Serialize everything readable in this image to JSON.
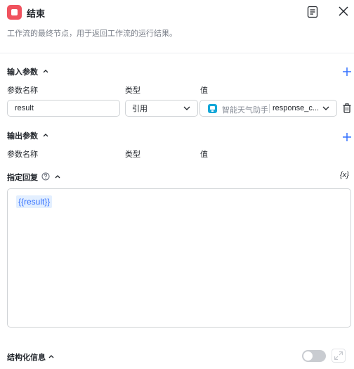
{
  "header": {
    "title": "结束",
    "subtitle": "工作流的最终节点，用于返回工作流的运行结果。",
    "node_icon": "end-node-icon",
    "doc_icon": "document-icon",
    "close_icon": "close-icon"
  },
  "input_section": {
    "title": "输入参数",
    "columns": [
      "参数名称",
      "类型",
      "值"
    ],
    "rows": [
      {
        "name": "result",
        "type": "引用",
        "ref_node": "智能天气助手",
        "ref_field": "response_c..."
      }
    ]
  },
  "output_section": {
    "title": "输出参数",
    "columns": [
      "参数名称",
      "类型",
      "值"
    ]
  },
  "reply_section": {
    "title": "指定回复",
    "var_icon_label": "{x}",
    "content": "{{result}}"
  },
  "structured_section": {
    "title": "结构化信息",
    "toggle_on": false
  },
  "colors": {
    "node_icon": "#f0525e",
    "accent": "#3370ff",
    "bot_icon": "#14a7d8"
  }
}
